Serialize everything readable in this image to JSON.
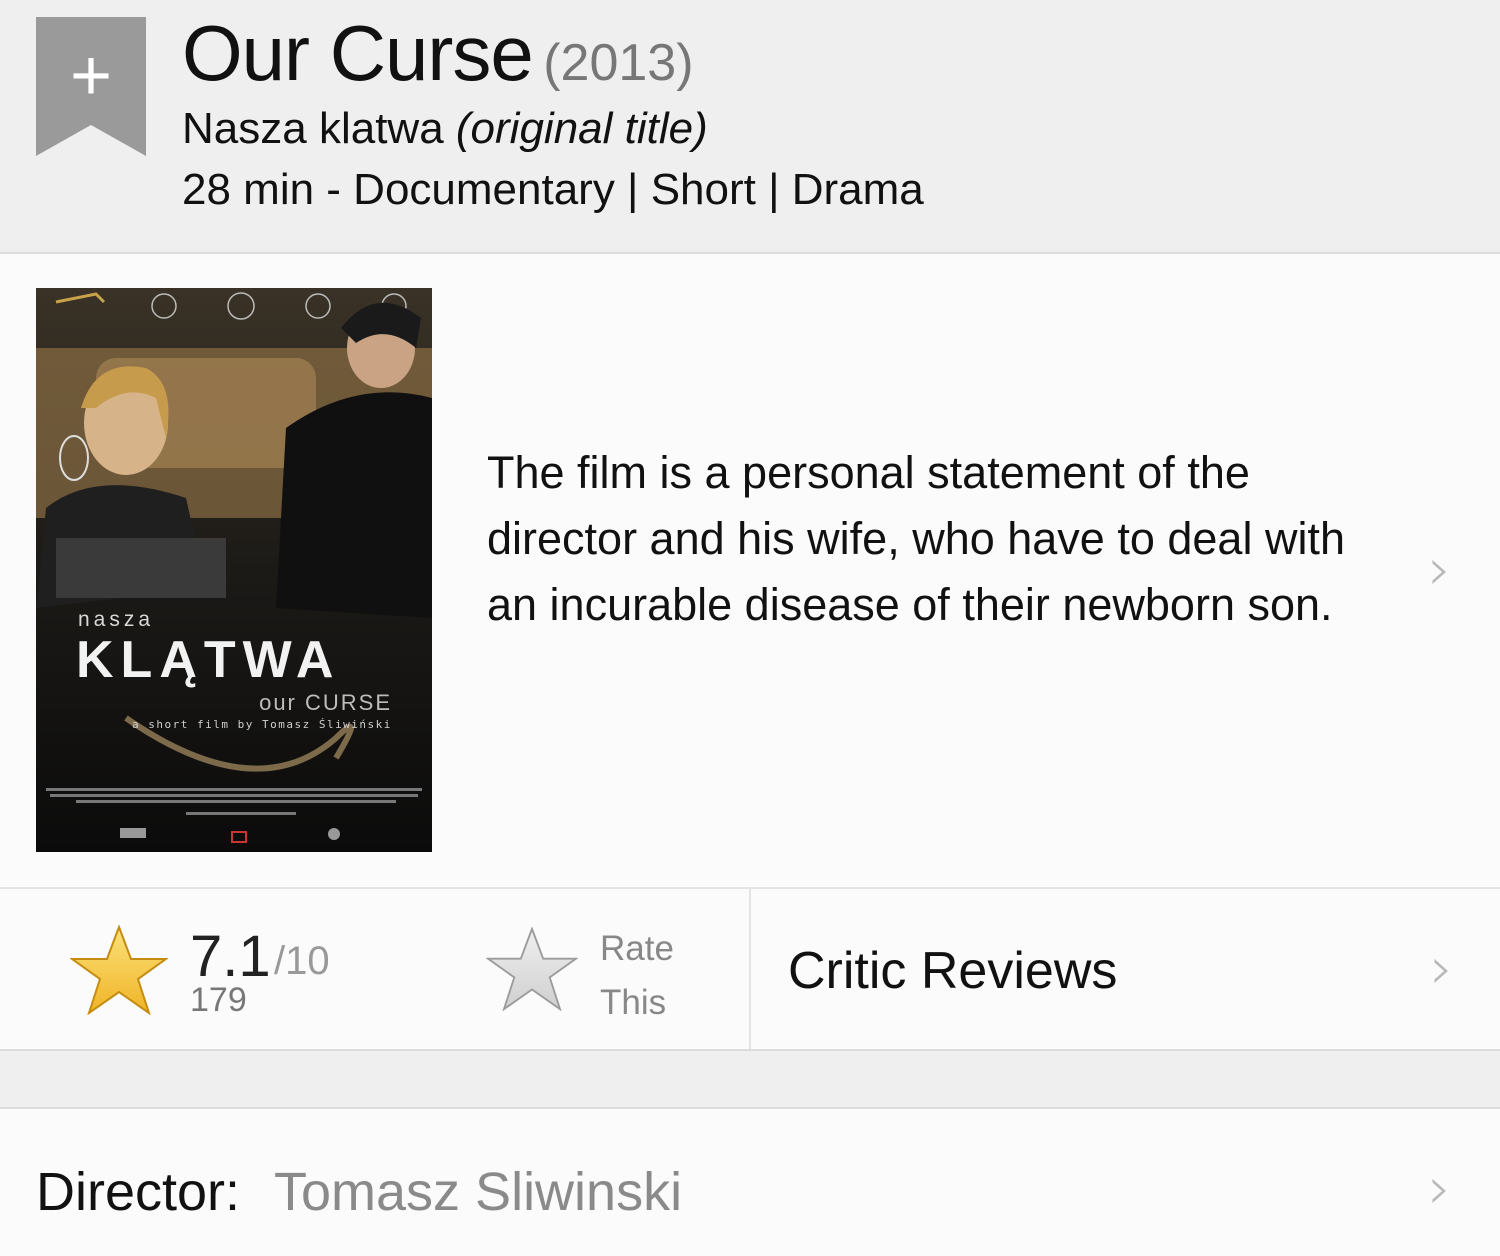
{
  "header": {
    "watchlist_icon": "plus-bookmark-icon",
    "title": "Our Curse",
    "year": "(2013)",
    "original_title": "Nasza klatwa",
    "original_title_note": "(original title)",
    "meta": "28 min - Documentary | Short | Drama"
  },
  "plot": {
    "poster": {
      "small_title": "nasza",
      "big_title": "KLĄTWA",
      "subtitle": "our CURSE",
      "byline": "a short film by Tomasz Śliwiński"
    },
    "summary": "The film is a personal statement of the director and his wife, who have to deal with an incurable disease of their newborn son.",
    "chevron": "›"
  },
  "rating": {
    "value": "7.1",
    "max": "/10",
    "count": "179",
    "rate_line1": "Rate",
    "rate_line2": "This",
    "critic_reviews": "Critic Reviews",
    "chevron": "›"
  },
  "director": {
    "label": "Director:",
    "name": "Tomasz Sliwinski",
    "chevron": "›"
  },
  "colors": {
    "accent_star": "#f2c233",
    "header_bg": "#efefef",
    "bookmark": "#9a9a9a"
  }
}
